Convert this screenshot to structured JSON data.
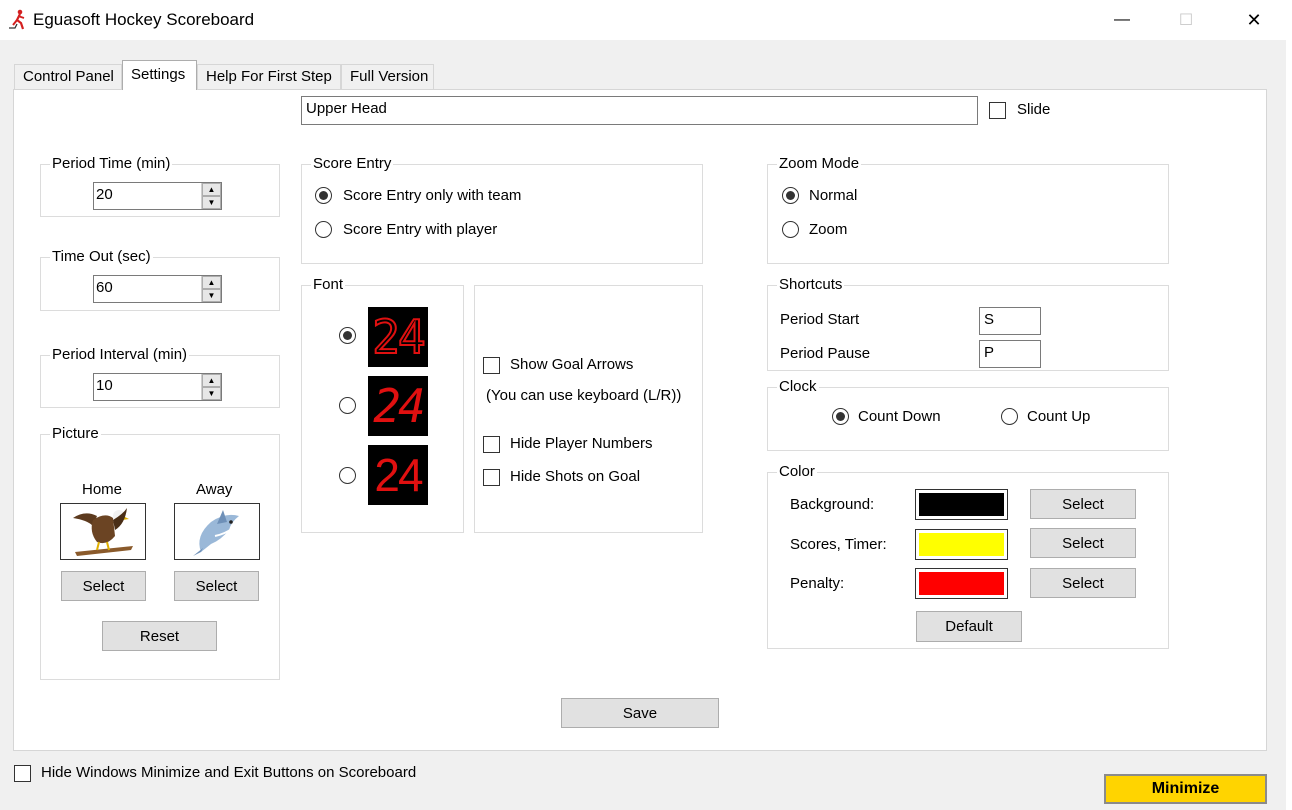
{
  "window": {
    "title": "Eguasoft Hockey Scoreboard",
    "minimize_glyph": "—",
    "maximize_glyph": "☐",
    "close_glyph": "✕"
  },
  "tabs": [
    {
      "label": "Control Panel"
    },
    {
      "label": "Settings"
    },
    {
      "label": "Help For First Step"
    },
    {
      "label": "Full Version"
    }
  ],
  "header": {
    "text_value": "Upper Head",
    "slide_label": "Slide",
    "slide_checked": false
  },
  "period_time": {
    "label": "Period Time (min)",
    "value": "20"
  },
  "time_out": {
    "label": "Time Out (sec)",
    "value": "60"
  },
  "period_interval": {
    "label": "Period Interval (min)",
    "value": "10"
  },
  "picture": {
    "label": "Picture",
    "home_label": "Home",
    "away_label": "Away",
    "home_select": "Select",
    "away_select": "Select",
    "reset": "Reset"
  },
  "score_entry": {
    "label": "Score Entry",
    "options": [
      "Score Entry only with team",
      "Score Entry with player"
    ],
    "selected": 0
  },
  "font": {
    "label": "Font",
    "samples": [
      "24",
      "24",
      "24"
    ],
    "selected": 0,
    "sample_color": "#e01010"
  },
  "options": {
    "show_goal_arrows": "Show Goal Arrows",
    "keyboard_note": "(You can use keyboard (L/R))",
    "hide_player_numbers": "Hide Player Numbers",
    "hide_shots_on_goal": "Hide Shots on Goal"
  },
  "zoom_mode": {
    "label": "Zoom Mode",
    "options": [
      "Normal",
      "Zoom"
    ],
    "selected": 0
  },
  "shortcuts": {
    "label": "Shortcuts",
    "period_start_label": "Period Start",
    "period_start_value": "S",
    "period_pause_label": "Period Pause",
    "period_pause_value": "P"
  },
  "clock": {
    "label": "Clock",
    "options": [
      "Count Down",
      "Count Up"
    ],
    "selected": 0
  },
  "color": {
    "label": "Color",
    "background_label": "Background:",
    "background_color": "#000000",
    "scores_timer_label": "Scores, Timer:",
    "scores_timer_color": "#ffff00",
    "penalty_label": "Penalty:",
    "penalty_color": "#ff0000",
    "select_label": "Select",
    "default_label": "Default"
  },
  "save_label": "Save",
  "footer": {
    "hide_buttons_label": "Hide Windows Minimize and Exit Buttons on Scoreboard",
    "minimize_label": "Minimize"
  }
}
